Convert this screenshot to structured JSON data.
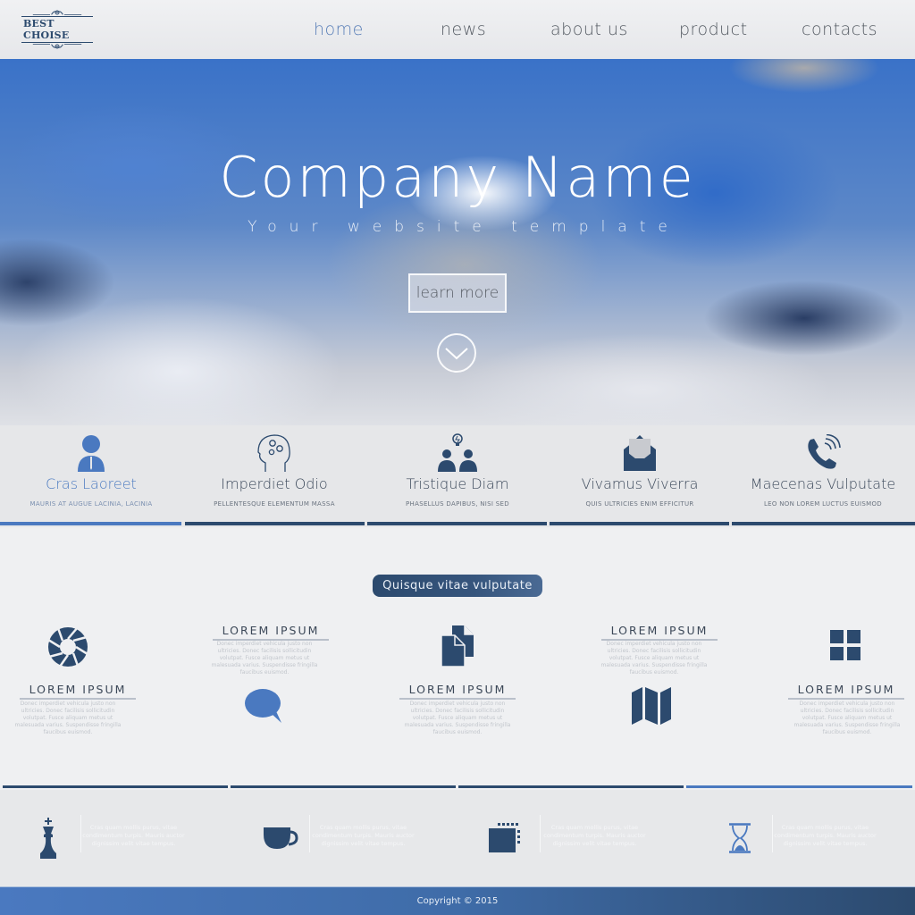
{
  "header": {
    "logo_text": "BEST CHOISE",
    "nav": [
      {
        "label": "home",
        "active": true
      },
      {
        "label": "news",
        "active": false
      },
      {
        "label": "about us",
        "active": false
      },
      {
        "label": "product",
        "active": false
      },
      {
        "label": "contacts",
        "active": false
      }
    ]
  },
  "hero": {
    "title": "Company Name",
    "subtitle": "Your website template",
    "button_label": "learn more",
    "scroll_icon": "chevron-down-circle-icon"
  },
  "features": [
    {
      "icon": "user-icon",
      "title": "Cras Laoreet",
      "subtitle": "MAURIS AT AUGUE LACINIA, LACINIA",
      "active": true
    },
    {
      "icon": "head-gears-icon",
      "title": "Imperdiet Odio",
      "subtitle": "PELLENTESQUE ELEMENTUM MASSA",
      "active": false
    },
    {
      "icon": "team-idea-icon",
      "title": "Tristique Diam",
      "subtitle": "PHASELLUS DAPIBUS, NISI SED",
      "active": false
    },
    {
      "icon": "envelope-open-icon",
      "title": "Vivamus Viverra",
      "subtitle": "QUIS ULTRICIES ENIM EFFICITUR",
      "active": false
    },
    {
      "icon": "phone-ringing-icon",
      "title": "Maecenas Vulputate",
      "subtitle": "LEO NON LOREM LUCTUS EUISMOD",
      "active": false
    }
  ],
  "middle": {
    "pill_label": "Quisque vitae vulputate",
    "cards": [
      {
        "icon": "aperture-icon",
        "title": "LOREM IPSUM",
        "body": "Donec imperdiet vehicula justo non ultricies. Donec facilisis sollicitudin volutpat. Fusce aliquam metus ut malesuada varius. Suspendisse fringilla faucibus euismod."
      },
      {
        "icon": "speech-bubble-icon",
        "title": "LOREM IPSUM",
        "body": "Donec imperdiet vehicula justo non ultricies. Donec facilisis sollicitudin volutpat. Fusce aliquam metus ut malesuada varius. Suspendisse fringilla faucibus euismod."
      },
      {
        "icon": "documents-icon",
        "title": "LOREM IPSUM",
        "body": "Donec imperdiet vehicula justo non ultricies. Donec facilisis sollicitudin volutpat. Fusce aliquam metus ut malesuada varius. Suspendisse fringilla faucibus euismod."
      },
      {
        "icon": "map-icon",
        "title": "LOREM IPSUM",
        "body": "Donec imperdiet vehicula justo non ultricies. Donec facilisis sollicitudin volutpat. Fusce aliquam metus ut malesuada varius. Suspendisse fringilla faucibus euismod."
      },
      {
        "icon": "grid-icon",
        "title": "LOREM IPSUM",
        "body": "Donec imperdiet vehicula justo non ultricies. Donec facilisis sollicitudin volutpat. Fusce aliquam metus ut malesuada varius. Suspendisse fringilla faucibus euismod."
      }
    ]
  },
  "bottom": [
    {
      "icon": "chess-king-icon",
      "text": "Cras quam mollis purus, vitae condimentum turpis. Mauris auctor dignissim velit vitae tempus."
    },
    {
      "icon": "cup-icon",
      "text": "Cras quam mollis purus, vitae condimentum turpis. Mauris auctor dignissim velit vitae tempus."
    },
    {
      "icon": "chip-icon",
      "text": "Cras quam mollis purus, vitae condimentum turpis. Mauris auctor dignissim velit vitae tempus."
    },
    {
      "icon": "hourglass-icon",
      "text": "Cras quam mollis purus, vitae condimentum turpis. Mauris auctor dignissim velit vitae tempus."
    }
  ],
  "footer": {
    "copyright": "Copyright © 2015"
  },
  "colors": {
    "primary_dark": "#2c4a6e",
    "accent_blue": "#4a79c0",
    "background": "#eeeff1"
  }
}
